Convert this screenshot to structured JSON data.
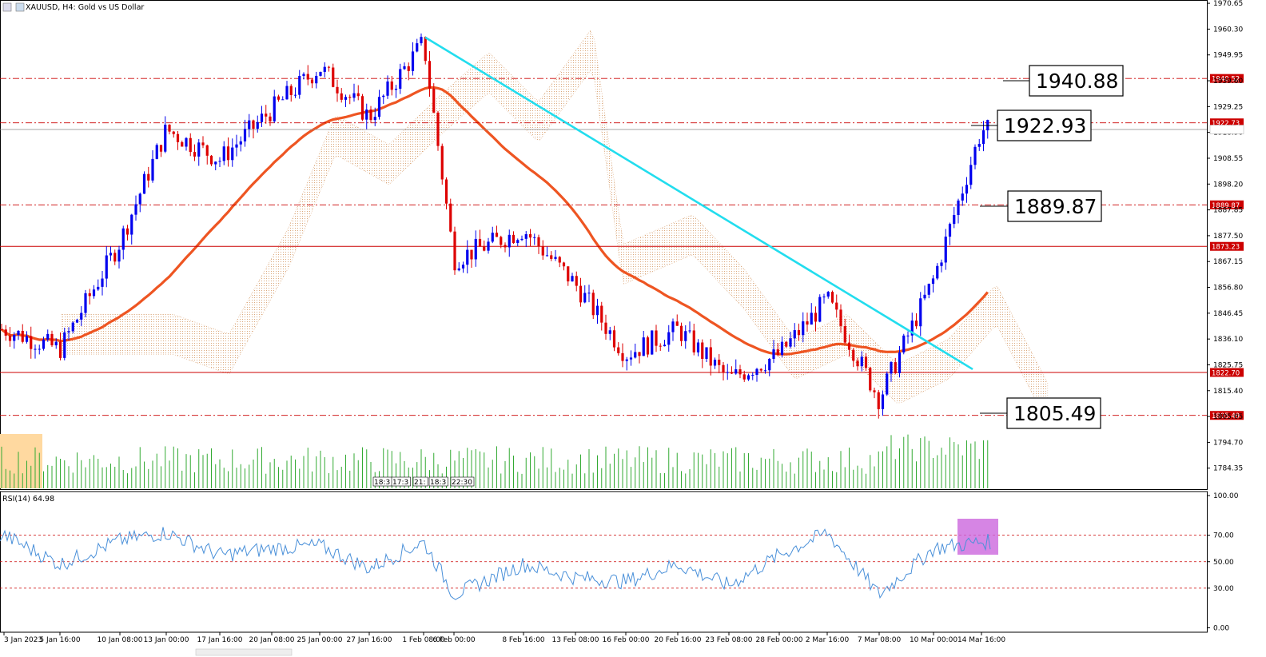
{
  "header": {
    "title": "XAUUSD, H4:  Gold vs US Dollar"
  },
  "colors": {
    "bull": "#0000ee",
    "bear": "#dd0000",
    "ma": "#ee5522",
    "trendline": "#22ddee",
    "level": "#cc0000",
    "cloud": "#d8a070",
    "cloud_blue": "#a8a8d8",
    "volume": "#33aa33",
    "rsi_line": "#4a90d9",
    "rsi_highlight": "#cc66dd",
    "volume_highlight": "#ffd9a0"
  },
  "chart_data": [
    {
      "type": "candlestick",
      "symbol": "XAUUSD",
      "timeframe": "H4",
      "ylim": [
        1775.0,
        1971.0
      ],
      "y_ticks": [
        "1970.65",
        "1960.30",
        "1949.95",
        "1939.60",
        "1929.25",
        "1918.90",
        "1908.55",
        "1898.20",
        "1887.85",
        "1877.50",
        "1867.15",
        "1856.80",
        "1846.45",
        "1836.10",
        "1825.75",
        "1815.40",
        "1805.05",
        "1794.70",
        "1784.35"
      ],
      "x_ticks": [
        "3 Jan 2023",
        "5 Jan 16:00",
        "10 Jan 08:00",
        "13 Jan 00:00",
        "17 Jan 16:00",
        "20 Jan 08:00",
        "25 Jan 00:00",
        "27 Jan 16:00",
        "1 Feb 08:00",
        "6 Feb 00:00",
        "8 Feb 16:00",
        "13 Feb 08:00",
        "16 Feb 00:00",
        "20 Feb 16:00",
        "23 Feb 08:00",
        "28 Feb 00:00",
        "2 Mar 16:00",
        "7 Mar 08:00",
        "10 Mar 00:00",
        "14 Mar 16:00"
      ],
      "path_keypoints": [
        {
          "t": "3 Jan 2023",
          "close": 1840
        },
        {
          "t": "5 Jan 16:00",
          "close": 1832
        },
        {
          "t": "10 Jan 08:00",
          "close": 1875
        },
        {
          "t": "13 Jan 00:00",
          "close": 1920
        },
        {
          "t": "17 Jan 16:00",
          "close": 1908
        },
        {
          "t": "20 Jan 08:00",
          "close": 1928
        },
        {
          "t": "25 Jan 00:00",
          "close": 1945
        },
        {
          "t": "27 Jan 16:00",
          "close": 1925
        },
        {
          "t": "1 Feb 08:00",
          "close": 1955
        },
        {
          "t": "6 Feb 00:00",
          "close": 1868
        },
        {
          "t": "8 Feb 16:00",
          "close": 1880
        },
        {
          "t": "13 Feb 08:00",
          "close": 1858
        },
        {
          "t": "16 Feb 00:00",
          "close": 1830
        },
        {
          "t": "20 Feb 16:00",
          "close": 1840
        },
        {
          "t": "23 Feb 08:00",
          "close": 1820
        },
        {
          "t": "28 Feb 00:00",
          "close": 1830
        },
        {
          "t": "2 Mar 16:00",
          "close": 1852
        },
        {
          "t": "7 Mar 08:00",
          "close": 1812
        },
        {
          "t": "10 Mar 00:00",
          "close": 1860
        },
        {
          "t": "14 Mar 16:00",
          "close": 1920
        }
      ],
      "levels": [
        {
          "value": 1940.52,
          "style": "dashdot",
          "tag": "1940.52"
        },
        {
          "value": 1922.73,
          "style": "dashdot",
          "tag": "1922.73"
        },
        {
          "value": 1889.87,
          "style": "dashdot",
          "tag": "1889.87"
        },
        {
          "value": 1873.23,
          "style": "solid",
          "tag": "1873.23"
        },
        {
          "value": 1822.7,
          "style": "solid",
          "tag": "1822.70"
        },
        {
          "value": 1805.49,
          "style": "dashdot",
          "tag": "1805.49"
        }
      ],
      "current_price": 1920.07,
      "callouts": [
        "1940.88",
        "1922.93",
        "1889.87",
        "1805.49"
      ],
      "trendline": {
        "from": {
          "t": "1 Feb 08:00",
          "price": 1957
        },
        "to": {
          "t": "14 Mar 16:00",
          "price": 1824
        }
      },
      "volume_time_labels": [
        "18:3",
        "17:3",
        "21:",
        "18:3",
        "22:30"
      ]
    },
    {
      "type": "line",
      "title": "RSI(14) 64.98",
      "ylim": [
        0,
        100
      ],
      "y_ticks": [
        "100.00",
        "70.00",
        "50.00",
        "30.00",
        "0.00"
      ],
      "levels": [
        70,
        50,
        30
      ],
      "keypoints": [
        {
          "t": "3 Jan 2023",
          "value": 70
        },
        {
          "t": "5 Jan 16:00",
          "value": 48
        },
        {
          "t": "10 Jan 08:00",
          "value": 66
        },
        {
          "t": "13 Jan 00:00",
          "value": 72
        },
        {
          "t": "17 Jan 16:00",
          "value": 55
        },
        {
          "t": "20 Jan 08:00",
          "value": 60
        },
        {
          "t": "25 Jan 00:00",
          "value": 62
        },
        {
          "t": "27 Jan 16:00",
          "value": 45
        },
        {
          "t": "1 Feb 08:00",
          "value": 65
        },
        {
          "t": "6 Feb 00:00",
          "value": 25
        },
        {
          "t": "8 Feb 16:00",
          "value": 48
        },
        {
          "t": "13 Feb 08:00",
          "value": 38
        },
        {
          "t": "16 Feb 00:00",
          "value": 35
        },
        {
          "t": "20 Feb 16:00",
          "value": 48
        },
        {
          "t": "23 Feb 08:00",
          "value": 32
        },
        {
          "t": "28 Feb 00:00",
          "value": 55
        },
        {
          "t": "2 Mar 16:00",
          "value": 72
        },
        {
          "t": "7 Mar 08:00",
          "value": 25
        },
        {
          "t": "10 Mar 00:00",
          "value": 60
        },
        {
          "t": "14 Mar 16:00",
          "value": 65
        }
      ],
      "last_value": 64.98
    }
  ]
}
